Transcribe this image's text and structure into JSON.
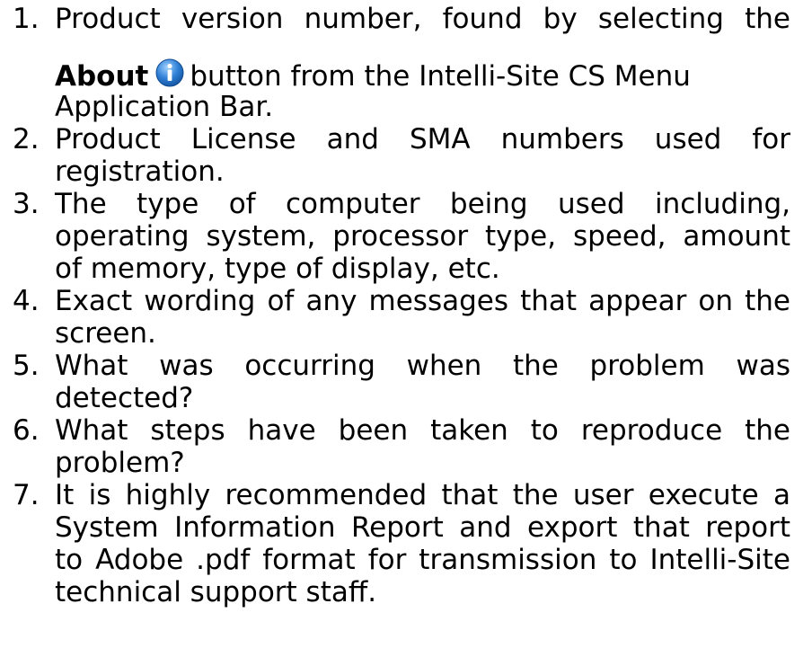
{
  "items": [
    {
      "number": "1.",
      "lines": [
        "Product version number, found by selecting the",
        "button from the Intelli-Site CS Menu",
        "Application Bar."
      ],
      "bold_word": "About",
      "icon": "info-icon"
    },
    {
      "number": "2.",
      "lines": [
        "Product License and SMA numbers used for",
        "registration."
      ]
    },
    {
      "number": "3.",
      "lines": [
        "The type of computer being used including,",
        "operating system, processor type, speed, amount",
        "of memory, type of display, etc."
      ]
    },
    {
      "number": "4.",
      "lines": [
        "Exact wording of any messages that appear on the",
        "screen."
      ]
    },
    {
      "number": "5.",
      "lines": [
        "What was occurring when the problem was",
        "detected?"
      ]
    },
    {
      "number": "6.",
      "lines": [
        "What steps have been taken to reproduce the",
        "problem?"
      ]
    },
    {
      "number": "7.",
      "lines": [
        "It is highly recommended that the user execute a",
        "System Information Report and export that report",
        "to Adobe .pdf format for transmission to Intelli-Site",
        "technical support staff."
      ]
    }
  ],
  "colors": {
    "text": "#000000",
    "icon_blue": "#2f7fd6"
  }
}
